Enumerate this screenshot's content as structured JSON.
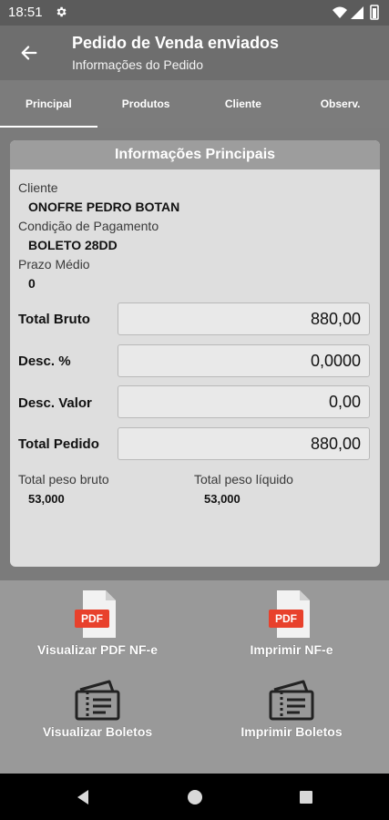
{
  "status_bar": {
    "time": "18:51"
  },
  "app_bar": {
    "title": "Pedido de Venda enviados",
    "subtitle": "Informações do Pedido"
  },
  "tabs": [
    {
      "label": "Principal",
      "active": true
    },
    {
      "label": "Produtos",
      "active": false
    },
    {
      "label": "Cliente",
      "active": false
    },
    {
      "label": "Observ.",
      "active": false
    }
  ],
  "card": {
    "header": "Informações Principais",
    "cliente_label": "Cliente",
    "cliente_value": "ONOFRE PEDRO BOTAN",
    "condicao_label": "Condição de Pagamento",
    "condicao_value": "BOLETO 28DD",
    "prazo_label": "Prazo Médio",
    "prazo_value": "0",
    "total_bruto_label": "Total Bruto",
    "total_bruto_value": "880,00",
    "desc_pct_label": "Desc. %",
    "desc_pct_value": "0,0000",
    "desc_valor_label": "Desc. Valor",
    "desc_valor_value": "0,00",
    "total_pedido_label": "Total Pedido",
    "total_pedido_value": "880,00",
    "peso_bruto_label": "Total peso bruto",
    "peso_bruto_value": "53,000",
    "peso_liquido_label": "Total peso líquido",
    "peso_liquido_value": "53,000"
  },
  "actions": {
    "pdf_badge": "PDF",
    "visualizar_pdf": "Visualizar PDF NF-e",
    "imprimir_nfe": "Imprimir NF-e",
    "visualizar_boletos": "Visualizar Boletos",
    "imprimir_boletos": "Imprimir Boletos"
  },
  "colors": {
    "status_bar": "#5b5b5b",
    "app_bar": "#6e6e6e",
    "tabs": "#7c7c7c",
    "card_header": "#9d9d9d",
    "pdf_red": "#e8412c"
  }
}
